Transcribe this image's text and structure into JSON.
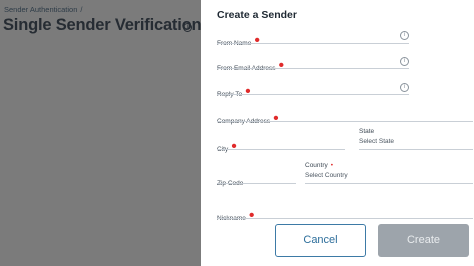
{
  "background_page": {
    "breadcrumb": "Sender Authentication",
    "breadcrumb_separator": "/",
    "title": "Single Sender Verification",
    "info_symbol": "i"
  },
  "panel": {
    "title": "Create a Sender",
    "required_marker": "•",
    "info_symbol": "i",
    "fields": {
      "from_name": {
        "label": "From Name",
        "value": ""
      },
      "from_email": {
        "label": "From Email Address",
        "value": ""
      },
      "reply_to": {
        "label": "Reply To",
        "value": ""
      },
      "company_address": {
        "label": "Company Address",
        "value": ""
      },
      "city": {
        "label": "City",
        "value": ""
      },
      "state": {
        "label": "State",
        "selected": "Select State"
      },
      "zip": {
        "label": "Zip Code",
        "value": ""
      },
      "country": {
        "label": "Country",
        "selected": "Select Country"
      },
      "nickname": {
        "label": "Nickname",
        "value": ""
      }
    },
    "buttons": {
      "cancel": "Cancel",
      "create": "Create"
    }
  },
  "colors": {
    "backdrop": "#7b7b7b",
    "required": "#e02b2b",
    "cancel_border": "#3d7aa6",
    "create_bg_disabled": "#9da4ab"
  }
}
